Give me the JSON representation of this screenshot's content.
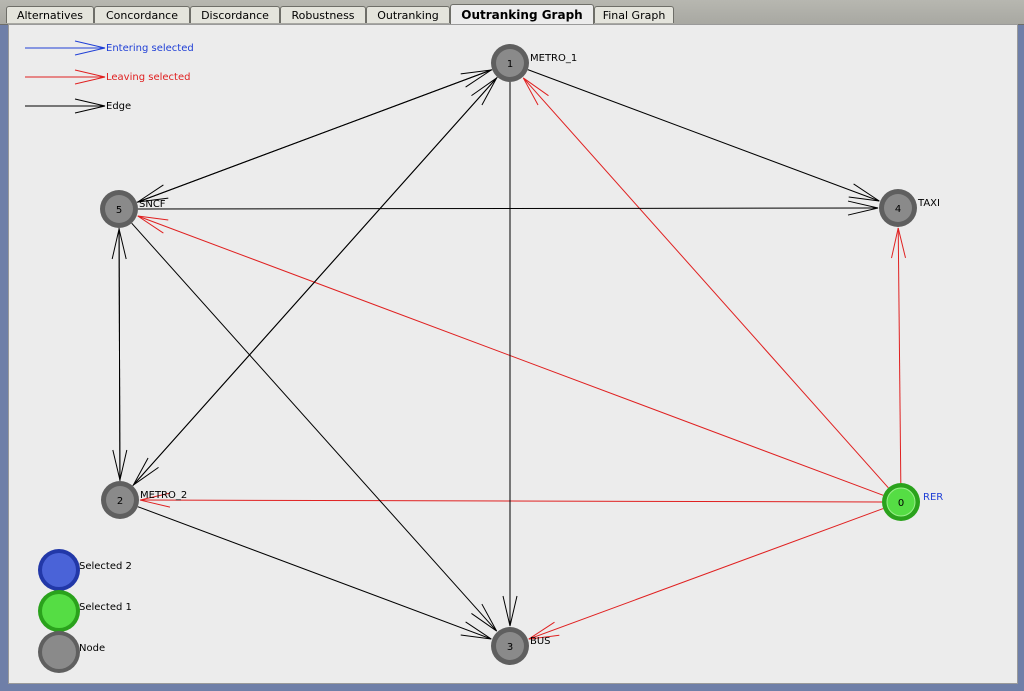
{
  "tabs": [
    {
      "label": "Alternatives"
    },
    {
      "label": "Concordance"
    },
    {
      "label": "Discordance"
    },
    {
      "label": "Robustness"
    },
    {
      "label": "Outranking"
    },
    {
      "label": "Outranking Graph"
    },
    {
      "label": "Final Graph"
    }
  ],
  "active_tab": "Outranking Graph",
  "legend": {
    "edge_items": [
      {
        "label": "Entering selected",
        "color": "#1f3fd6"
      },
      {
        "label": "Leaving selected",
        "color": "#e02020"
      },
      {
        "label": "Edge",
        "color": "#000000"
      }
    ],
    "node_items": [
      {
        "label": "Selected 2",
        "color": "#4a63d8"
      },
      {
        "label": "Selected 1",
        "color": "#55dd44"
      },
      {
        "label": "Node",
        "color": "#8a8a8a"
      }
    ]
  },
  "nodes": [
    {
      "id": "0",
      "name": "RER",
      "state": "selected1"
    },
    {
      "id": "1",
      "name": "METRO_1",
      "state": "normal"
    },
    {
      "id": "2",
      "name": "METRO_2",
      "state": "normal"
    },
    {
      "id": "3",
      "name": "BUS",
      "state": "normal"
    },
    {
      "id": "4",
      "name": "TAXI",
      "state": "normal"
    },
    {
      "id": "5",
      "name": "SNCF",
      "state": "normal"
    }
  ],
  "edges": [
    {
      "from": "0",
      "to": "1",
      "kind": "leaving"
    },
    {
      "from": "0",
      "to": "2",
      "kind": "leaving"
    },
    {
      "from": "0",
      "to": "3",
      "kind": "leaving"
    },
    {
      "from": "0",
      "to": "4",
      "kind": "leaving"
    },
    {
      "from": "0",
      "to": "5",
      "kind": "leaving"
    },
    {
      "from": "1",
      "to": "4",
      "kind": "edge"
    },
    {
      "from": "1",
      "to": "3",
      "kind": "edge"
    },
    {
      "from": "1",
      "to": "5",
      "kind": "edge"
    },
    {
      "from": "5",
      "to": "1",
      "kind": "edge"
    },
    {
      "from": "1",
      "to": "2",
      "kind": "edge"
    },
    {
      "from": "2",
      "to": "1",
      "kind": "edge"
    },
    {
      "from": "5",
      "to": "4",
      "kind": "edge"
    },
    {
      "from": "5",
      "to": "2",
      "kind": "edge"
    },
    {
      "from": "2",
      "to": "5",
      "kind": "edge"
    },
    {
      "from": "5",
      "to": "3",
      "kind": "edge"
    },
    {
      "from": "2",
      "to": "3",
      "kind": "edge"
    }
  ],
  "colors": {
    "node_normal": "#8a8a8a",
    "node_selected1": "#55dd44",
    "node_selected2": "#4a63d8",
    "leaving": "#e02020",
    "entering": "#1f3fd6",
    "edge": "#000000",
    "selected_label": "#1f3fd6"
  }
}
